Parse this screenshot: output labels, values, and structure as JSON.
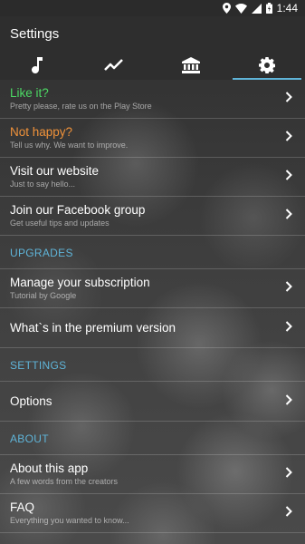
{
  "status_bar": {
    "time": "1:44",
    "icons": [
      "location-icon",
      "wifi-icon",
      "signal-icon",
      "battery-icon"
    ]
  },
  "header": {
    "title": "Settings"
  },
  "tabs": [
    {
      "icon": "music-note-icon",
      "active": false
    },
    {
      "icon": "trend-line-icon",
      "active": false
    },
    {
      "icon": "bank-icon",
      "active": false
    },
    {
      "icon": "gear-icon",
      "active": true
    }
  ],
  "colors": {
    "accent": "#5fb4d8",
    "like_it": "#4cd964",
    "not_happy": "#f0923a"
  },
  "items": {
    "like_it": {
      "title": "Like it?",
      "subtitle": "Pretty please, rate us on the Play Store"
    },
    "not_happy": {
      "title": "Not happy?",
      "subtitle": "Tell us why. We want to improve."
    },
    "website": {
      "title": "Visit our website",
      "subtitle": "Just to say hello..."
    },
    "facebook": {
      "title": "Join our Facebook group",
      "subtitle": "Get useful tips and updates"
    },
    "subscription": {
      "title": "Manage your subscription",
      "subtitle": "Tutorial by Google"
    },
    "premium": {
      "title": "What`s in the premium version"
    },
    "options": {
      "title": "Options"
    },
    "about": {
      "title": "About this app",
      "subtitle": "A few words from the creators"
    },
    "faq": {
      "title": "FAQ",
      "subtitle": "Everything you wanted to know..."
    }
  },
  "sections": {
    "upgrades": "UPGRADES",
    "settings": "SETTINGS",
    "about": "ABOUT"
  }
}
